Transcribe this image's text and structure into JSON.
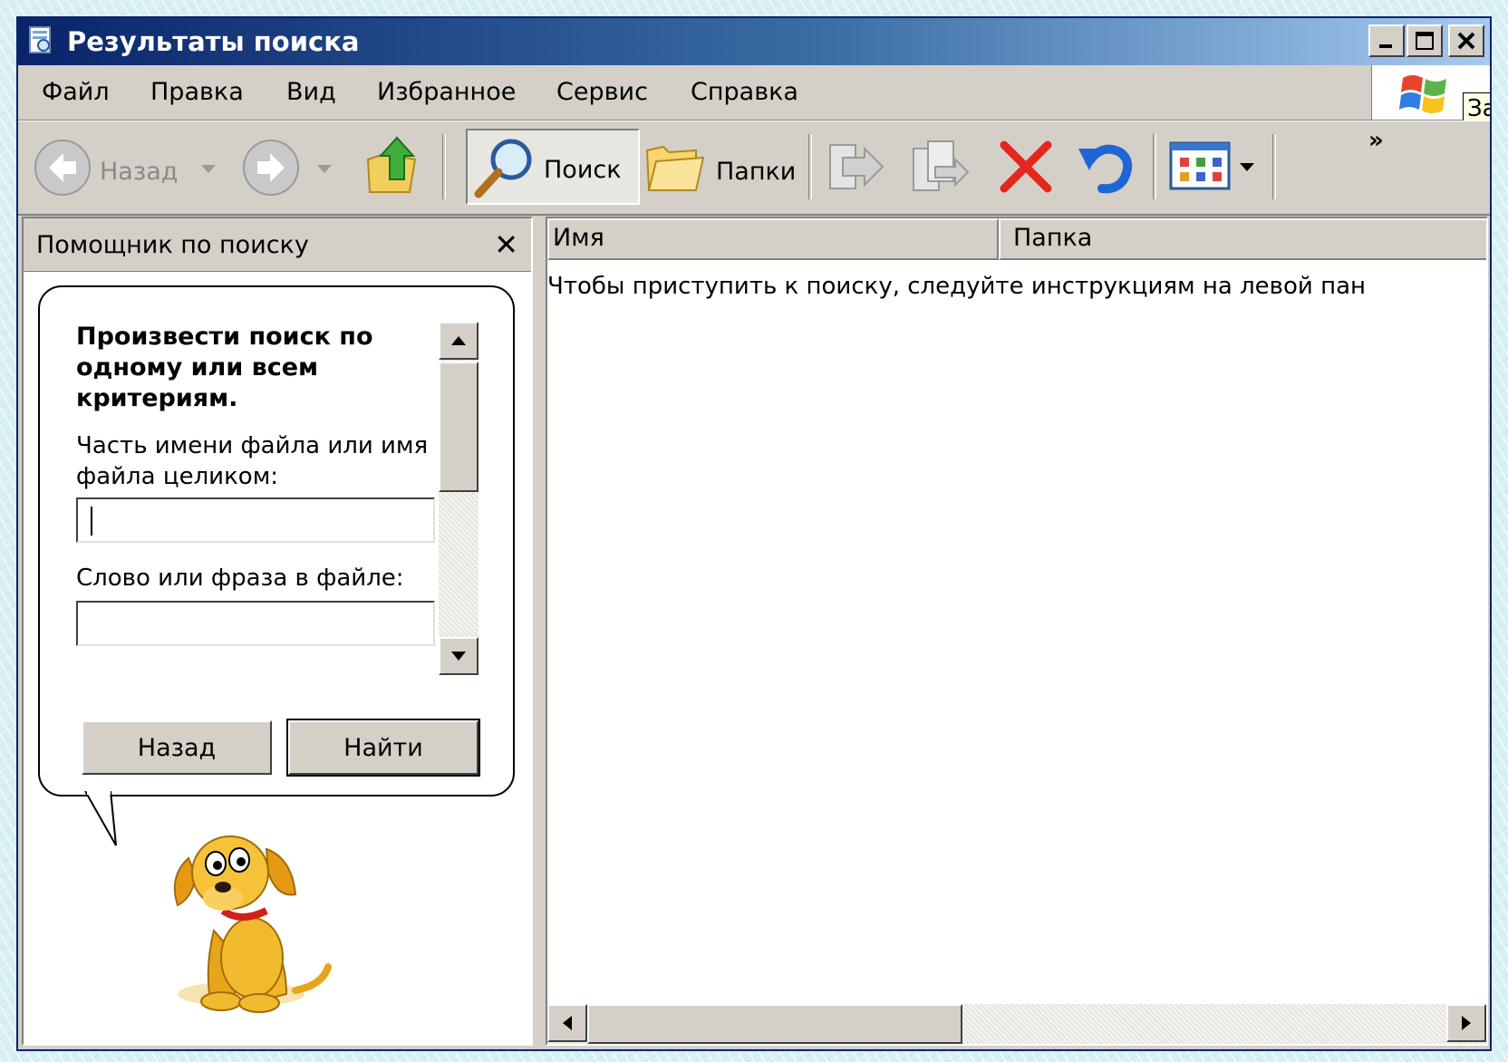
{
  "window": {
    "title": "Результаты поиска"
  },
  "menu": {
    "items": [
      {
        "label": "Файл"
      },
      {
        "label": "Правка"
      },
      {
        "label": "Вид"
      },
      {
        "label": "Избранное"
      },
      {
        "label": "Сервис"
      },
      {
        "label": "Справка"
      }
    ],
    "tooltip": "За"
  },
  "toolbar": {
    "back_label": "Назад",
    "search_label": "Поиск",
    "folders_label": "Папки",
    "more": "»"
  },
  "search_assistant": {
    "title": "Помощник по поиску",
    "close_glyph": "✕",
    "heading": "Произвести поиск по одному или всем критериям.",
    "filename_label": "Часть имени файла или имя файла целиком:",
    "filename_value": "",
    "phrase_label": "Слово или фраза в файле:",
    "phrase_value": "",
    "back_button": "Назад",
    "find_button": "Найти"
  },
  "results": {
    "columns": [
      {
        "label": "Имя"
      },
      {
        "label": "Папка"
      }
    ],
    "message": "Чтобы приступить к поиску, следуйте инструкциям на левой пан"
  },
  "colors": {
    "titlebar_start": "#0a246a",
    "titlebar_end": "#a6caf0",
    "chrome": "#d4d0c8",
    "delete_red": "#e3261e",
    "undo_blue": "#1f66d4"
  }
}
